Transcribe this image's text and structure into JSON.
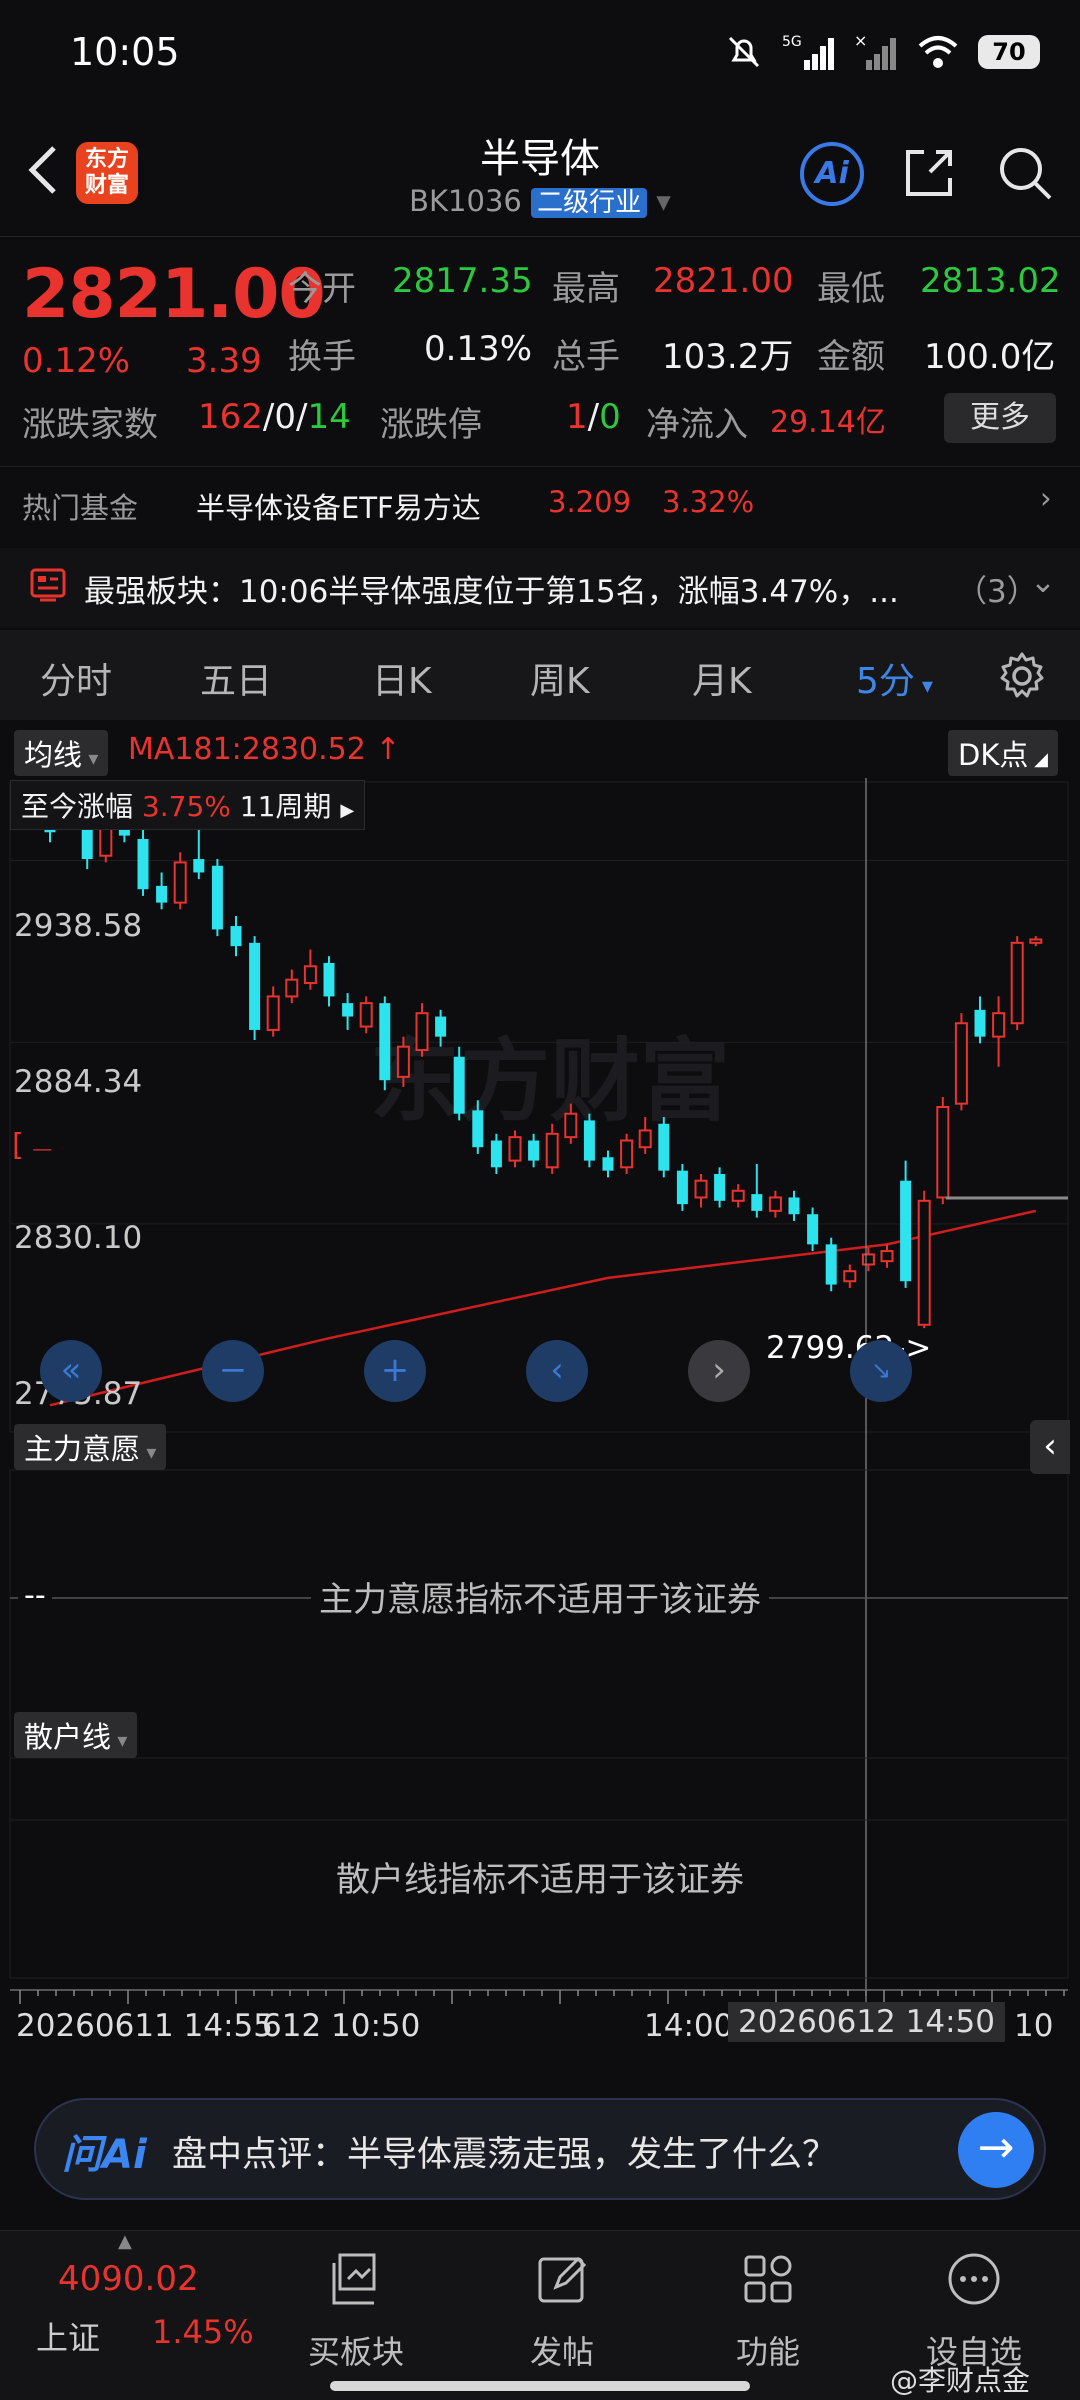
{
  "status_bar": {
    "time": "10:05",
    "battery": "70"
  },
  "header": {
    "title": "半导体",
    "code": "BK1036",
    "tag": "二级行业",
    "logo": "东方财富",
    "ai_label": "Ai"
  },
  "quote": {
    "price": "2821.00",
    "change_pct": "0.12%",
    "change": "3.39",
    "open_label": "今开",
    "open": "2817.35",
    "high_label": "最高",
    "high": "2821.00",
    "low_label": "最低",
    "low": "2813.02",
    "turnover_label": "换手",
    "turnover": "0.13%",
    "volume_label": "总手",
    "volume": "103.2万",
    "amount_label": "金额",
    "amount": "100.0亿",
    "breadth_label": "涨跌家数",
    "up": "162",
    "flat": "0",
    "down": "14",
    "limit_label": "涨跌停",
    "limit_up": "1",
    "limit_down": "0",
    "netflow_label": "净流入",
    "netflow": "29.14亿",
    "more": "更多"
  },
  "fund": {
    "label": "热门基金",
    "name": "半导体设备ETF易方达",
    "price": "3.209",
    "pct": "3.32%"
  },
  "strong": {
    "text": "最强板块：10:06半导体强度位于第15名，涨幅3.47%，...",
    "count": "（3）"
  },
  "tabs": [
    "分时",
    "五日",
    "日K",
    "周K",
    "月K",
    "5分",
    "settings"
  ],
  "chart_top": {
    "ma_chip": "均线",
    "ma": "MA181:2830.52",
    "dk": "DK点",
    "period_label": "至今涨幅",
    "period_pct": "3.75%",
    "period_count": "11周期"
  },
  "chart_data": {
    "type": "candlestick",
    "y_ticks": [
      "2938.58",
      "2884.34",
      "2830.10",
      "2775.87"
    ],
    "ylim": [
      2768,
      2962
    ],
    "annotation": "2799.62->",
    "x_labels": [
      "20260611 14:55",
      "612 10:50",
      "14:00",
      "20260612 14:50",
      "10"
    ],
    "candles": [
      {
        "o": 2957,
        "c": 2947,
        "h": 2962,
        "l": 2944
      },
      {
        "o": 2952,
        "c": 2958,
        "h": 2961,
        "l": 2949
      },
      {
        "o": 2957,
        "c": 2939,
        "h": 2962,
        "l": 2936
      },
      {
        "o": 2940,
        "c": 2955,
        "h": 2958,
        "l": 2938
      },
      {
        "o": 2953,
        "c": 2946,
        "h": 2955,
        "l": 2944
      },
      {
        "o": 2945,
        "c": 2930,
        "h": 2948,
        "l": 2928
      },
      {
        "o": 2931,
        "c": 2926,
        "h": 2935,
        "l": 2924
      },
      {
        "o": 2926,
        "c": 2938,
        "h": 2941,
        "l": 2924
      },
      {
        "o": 2939,
        "c": 2935,
        "h": 2949,
        "l": 2933
      },
      {
        "o": 2937,
        "c": 2918,
        "h": 2939,
        "l": 2916
      },
      {
        "o": 2919,
        "c": 2913,
        "h": 2922,
        "l": 2910
      },
      {
        "o": 2914,
        "c": 2888,
        "h": 2916,
        "l": 2885
      },
      {
        "o": 2888,
        "c": 2898,
        "h": 2901,
        "l": 2886
      },
      {
        "o": 2898,
        "c": 2903,
        "h": 2906,
        "l": 2896
      },
      {
        "o": 2902,
        "c": 2907,
        "h": 2912,
        "l": 2900
      },
      {
        "o": 2908,
        "c": 2898,
        "h": 2910,
        "l": 2895
      },
      {
        "o": 2896,
        "c": 2892,
        "h": 2899,
        "l": 2888
      },
      {
        "o": 2889,
        "c": 2896,
        "h": 2898,
        "l": 2887
      },
      {
        "o": 2896,
        "c": 2873,
        "h": 2898,
        "l": 2870
      },
      {
        "o": 2874,
        "c": 2883,
        "h": 2886,
        "l": 2871
      },
      {
        "o": 2882,
        "c": 2893,
        "h": 2896,
        "l": 2880
      },
      {
        "o": 2892,
        "c": 2886,
        "h": 2894,
        "l": 2883
      },
      {
        "o": 2880,
        "c": 2863,
        "h": 2883,
        "l": 2861
      },
      {
        "o": 2864,
        "c": 2853,
        "h": 2867,
        "l": 2851
      },
      {
        "o": 2855,
        "c": 2847,
        "h": 2857,
        "l": 2845
      },
      {
        "o": 2849,
        "c": 2856,
        "h": 2858,
        "l": 2847
      },
      {
        "o": 2855,
        "c": 2849,
        "h": 2857,
        "l": 2847
      },
      {
        "o": 2847,
        "c": 2857,
        "h": 2860,
        "l": 2845
      },
      {
        "o": 2856,
        "c": 2863,
        "h": 2866,
        "l": 2854
      },
      {
        "o": 2861,
        "c": 2849,
        "h": 2863,
        "l": 2847
      },
      {
        "o": 2850,
        "c": 2846,
        "h": 2852,
        "l": 2844
      },
      {
        "o": 2847,
        "c": 2855,
        "h": 2857,
        "l": 2845
      },
      {
        "o": 2853,
        "c": 2858,
        "h": 2862,
        "l": 2851
      },
      {
        "o": 2860,
        "c": 2846,
        "h": 2862,
        "l": 2844
      },
      {
        "o": 2846,
        "c": 2836,
        "h": 2848,
        "l": 2834
      },
      {
        "o": 2838,
        "c": 2843,
        "h": 2845,
        "l": 2835
      },
      {
        "o": 2845,
        "c": 2837,
        "h": 2847,
        "l": 2835
      },
      {
        "o": 2837,
        "c": 2840,
        "h": 2842,
        "l": 2835
      },
      {
        "o": 2839,
        "c": 2834,
        "h": 2848,
        "l": 2832
      },
      {
        "o": 2834,
        "c": 2838,
        "h": 2840,
        "l": 2832
      },
      {
        "o": 2838,
        "c": 2833,
        "h": 2840,
        "l": 2831
      },
      {
        "o": 2833,
        "c": 2824,
        "h": 2835,
        "l": 2822
      },
      {
        "o": 2824,
        "c": 2812,
        "h": 2826,
        "l": 2810
      },
      {
        "o": 2813,
        "c": 2816,
        "h": 2818,
        "l": 2811
      },
      {
        "o": 2818,
        "c": 2821,
        "h": 2823,
        "l": 2816
      },
      {
        "o": 2819,
        "c": 2822,
        "h": 2824,
        "l": 2817
      },
      {
        "o": 2843,
        "c": 2813,
        "h": 2849,
        "l": 2811
      },
      {
        "o": 2800,
        "c": 2837,
        "h": 2840,
        "l": 2799
      },
      {
        "o": 2838,
        "c": 2865,
        "h": 2868,
        "l": 2836
      },
      {
        "o": 2866,
        "c": 2890,
        "h": 2893,
        "l": 2864
      },
      {
        "o": 2894,
        "c": 2886,
        "h": 2898,
        "l": 2884
      },
      {
        "o": 2886,
        "c": 2893,
        "h": 2898,
        "l": 2877
      },
      {
        "o": 2890,
        "c": 2914,
        "h": 2916,
        "l": 2888
      },
      {
        "o": 2914,
        "c": 2915,
        "h": 2916,
        "l": 2913
      }
    ],
    "ma": [
      [
        0,
        2776
      ],
      [
        15,
        2796
      ],
      [
        30,
        2814
      ],
      [
        45,
        2824
      ],
      [
        53,
        2834
      ]
    ]
  },
  "panel1": {
    "chip": "主力意愿",
    "message": "主力意愿指标不适用于该证券",
    "value": "--"
  },
  "panel2": {
    "chip": "散户线",
    "message": "散户线指标不适用于该证券"
  },
  "ask": {
    "logo": "问Ai",
    "text": "盘中点评：半导体震荡走强，发生了什么？"
  },
  "bottom_nav": {
    "index_value": "4090.02",
    "index_name": "上证",
    "index_pct": "1.45%",
    "items": [
      "买板块",
      "发帖",
      "功能",
      "设自选"
    ],
    "watermark": "@李财点金"
  },
  "colors": {
    "up": "#e8332f",
    "down": "#2de3ee",
    "ma": "#d01d1d"
  }
}
